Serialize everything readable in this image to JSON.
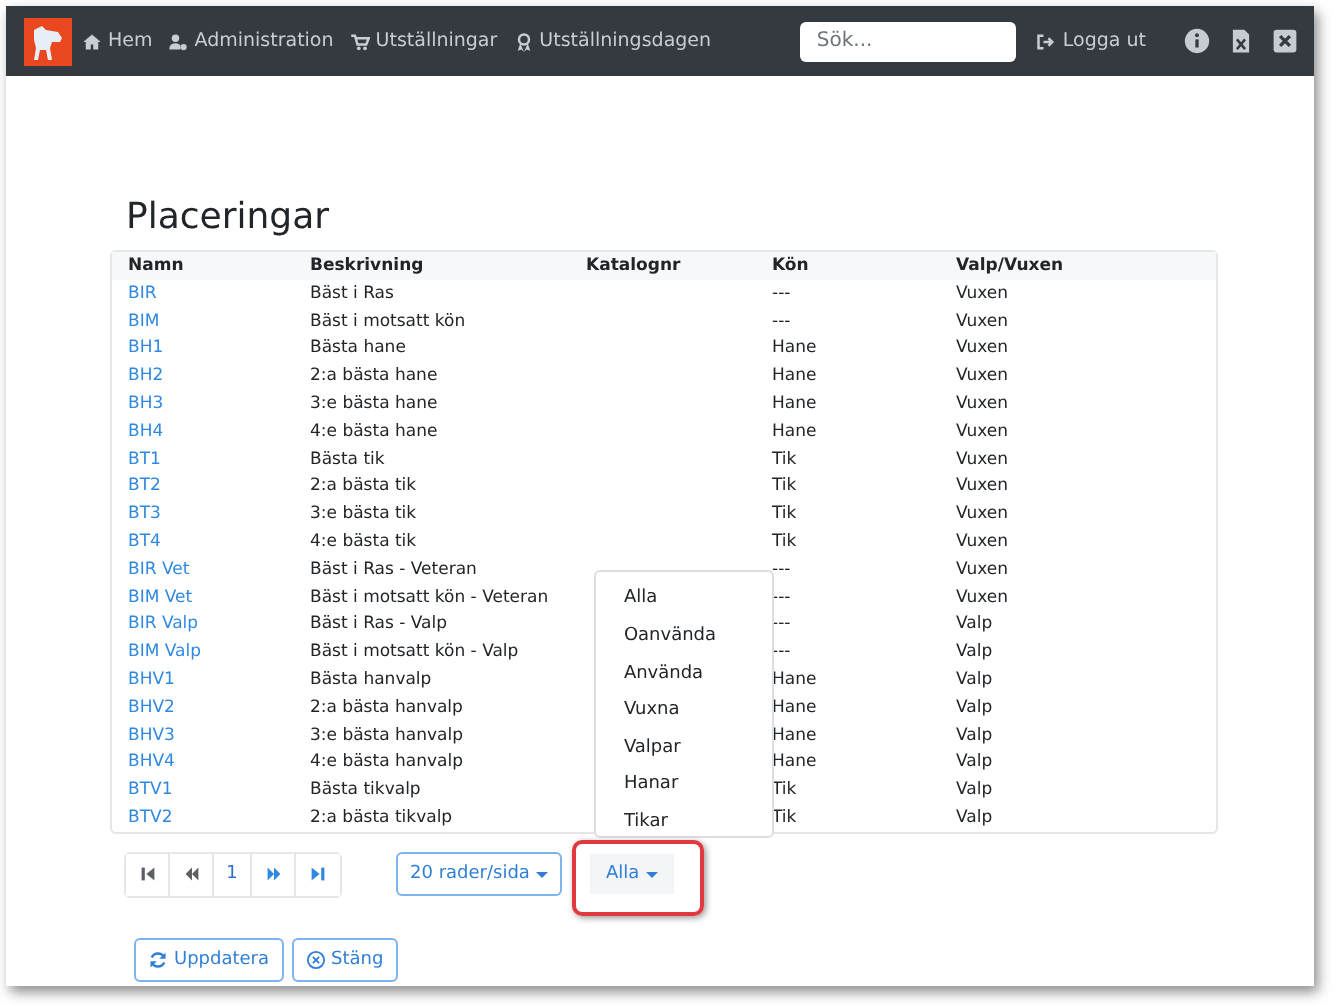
{
  "navbar": {
    "links": [
      {
        "label": "Hem"
      },
      {
        "label": "Administration"
      },
      {
        "label": "Utställningar"
      },
      {
        "label": "Utställningsdagen"
      }
    ],
    "search": {
      "placeholder": "Sök..."
    },
    "logout": "Logga ut"
  },
  "title": "Placeringar",
  "table": {
    "columns": [
      "Namn",
      "Beskrivning",
      "Katalognr",
      "Kön",
      "Valp/Vuxen"
    ],
    "rows": [
      [
        "BIR",
        "Bäst i Ras",
        "",
        "---",
        "Vuxen"
      ],
      [
        "BIM",
        "Bäst i motsatt kön",
        "",
        "---",
        "Vuxen"
      ],
      [
        "BH1",
        "Bästa hane",
        "",
        "Hane",
        "Vuxen"
      ],
      [
        "BH2",
        "2:a bästa hane",
        "",
        "Hane",
        "Vuxen"
      ],
      [
        "BH3",
        "3:e bästa hane",
        "",
        "Hane",
        "Vuxen"
      ],
      [
        "BH4",
        "4:e bästa hane",
        "",
        "Hane",
        "Vuxen"
      ],
      [
        "BT1",
        "Bästa tik",
        "",
        "Tik",
        "Vuxen"
      ],
      [
        "BT2",
        "2:a bästa tik",
        "",
        "Tik",
        "Vuxen"
      ],
      [
        "BT3",
        "3:e bästa tik",
        "",
        "Tik",
        "Vuxen"
      ],
      [
        "BT4",
        "4:e bästa tik",
        "",
        "Tik",
        "Vuxen"
      ],
      [
        "BIR Vet",
        "Bäst i Ras - Veteran",
        "",
        "---",
        "Vuxen"
      ],
      [
        "BIM Vet",
        "Bäst i motsatt kön - Veteran",
        "",
        "---",
        "Vuxen"
      ],
      [
        "BIR Valp",
        "Bäst i Ras - Valp",
        "",
        "---",
        "Valp"
      ],
      [
        "BIM Valp",
        "Bäst i motsatt kön - Valp",
        "",
        "---",
        "Valp"
      ],
      [
        "BHV1",
        "Bästa hanvalp",
        "",
        "Hane",
        "Valp"
      ],
      [
        "BHV2",
        "2:a bästa hanvalp",
        "",
        "Hane",
        "Valp"
      ],
      [
        "BHV3",
        "3:e bästa hanvalp",
        "",
        "Hane",
        "Valp"
      ],
      [
        "BHV4",
        "4:e bästa hanvalp",
        "",
        "Hane",
        "Valp"
      ],
      [
        "BTV1",
        "Bästa tikvalp",
        "",
        "Tik",
        "Valp"
      ],
      [
        "BTV2",
        "2:a bästa tikvalp",
        "",
        "Tik",
        "Valp"
      ]
    ]
  },
  "pagination": {
    "page": "1"
  },
  "page_size": "20 rader/sida",
  "filter": {
    "label": "Alla",
    "menu": [
      "Alla",
      "Oanvända",
      "Använda",
      "Vuxna",
      "Valpar",
      "Hanar",
      "Tikar"
    ]
  },
  "buttons": [
    {
      "label": "Uppdatera"
    },
    {
      "label": "Stäng"
    }
  ]
}
